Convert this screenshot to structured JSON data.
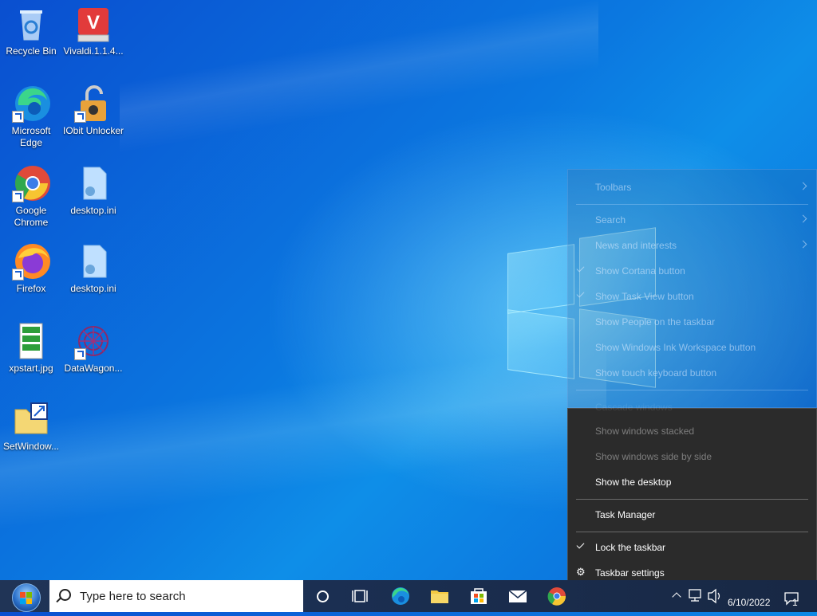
{
  "desktop": {
    "icons": [
      {
        "label": "Recycle Bin"
      },
      {
        "label": "Vivaldi.1.1.4..."
      },
      {
        "label": "Microsoft Edge"
      },
      {
        "label": "IObit Unlocker"
      },
      {
        "label": "Google Chrome"
      },
      {
        "label": "desktop.ini"
      },
      {
        "label": "Firefox"
      },
      {
        "label": "desktop.ini"
      },
      {
        "label": "xpstart.jpg"
      },
      {
        "label": "DataWagon..."
      },
      {
        "label": "SetWindow..."
      }
    ]
  },
  "context_menu": {
    "items": [
      {
        "label": "Toolbars",
        "submenu": true
      },
      {
        "label": "Search",
        "submenu": true
      },
      {
        "label": "News and interests",
        "submenu": true
      },
      {
        "label": "Show Cortana button",
        "checked": true
      },
      {
        "label": "Show Task View button",
        "checked": true
      },
      {
        "label": "Show People on the taskbar"
      },
      {
        "label": "Show Windows Ink Workspace button"
      },
      {
        "label": "Show touch keyboard button"
      },
      {
        "label": "Cascade windows",
        "disabled": true
      },
      {
        "label": "Show windows stacked",
        "disabled": true
      },
      {
        "label": "Show windows side by side",
        "disabled": true
      },
      {
        "label": "Show the desktop"
      },
      {
        "label": "Task Manager"
      },
      {
        "label": "Lock the taskbar",
        "checked": true
      },
      {
        "label": "Taskbar settings"
      }
    ]
  },
  "taskbar": {
    "search_placeholder": "Type here to search",
    "clock_date": "6/10/2022",
    "notification_count": "1",
    "pinned": [
      "cortana-icon",
      "task-view-icon",
      "edge-icon",
      "file-explorer-icon",
      "store-icon",
      "mail-icon",
      "chrome-icon"
    ]
  },
  "colors": {
    "menu_bg": "#2b2b2b",
    "taskbar_bg": "#1b2f52",
    "desktop_blue": "#0b78e0"
  }
}
